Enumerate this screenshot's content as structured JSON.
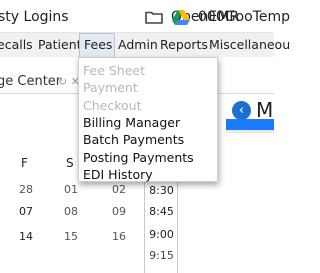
{
  "bookmarks": {
    "items": [
      {
        "label": "sty Logins",
        "icon": "none"
      },
      {
        "label": "OpenEMR",
        "icon": "folder-icon"
      },
      {
        "label": "000GooTemp",
        "icon": "google-drive-icon"
      }
    ]
  },
  "menubar": {
    "items": [
      "ecalls",
      "Patient",
      "Fees",
      "Admin",
      "Reports",
      "Miscellaneou"
    ],
    "active": "Fees"
  },
  "fees_menu": {
    "items": [
      {
        "label": "Fee Sheet",
        "enabled": false
      },
      {
        "label": "Payment",
        "enabled": false
      },
      {
        "label": "Checkout",
        "enabled": false
      },
      {
        "label": "Billing Manager",
        "enabled": true
      },
      {
        "label": "Batch Payments",
        "enabled": true
      },
      {
        "label": "Posting Payments",
        "enabled": true
      },
      {
        "label": "EDI History",
        "enabled": true
      }
    ]
  },
  "background": {
    "tab_label": "ge Center",
    "tab_icons": "↻  ✕",
    "panel_initial": "M",
    "calendar": {
      "headers": [
        "F",
        "S"
      ],
      "rows": [
        [
          "28",
          "01",
          "02"
        ],
        [
          "07",
          "08",
          "09"
        ],
        [
          "14",
          "15",
          "16"
        ]
      ]
    },
    "times": [
      "8:30",
      "8:45",
      "9:00",
      "9:15"
    ]
  },
  "colors": {
    "accent": "#1a7bff",
    "menu_bar": "#f1f1f1",
    "active_menu": "#e3e9f1",
    "disabled_text": "#b8b8b8"
  }
}
